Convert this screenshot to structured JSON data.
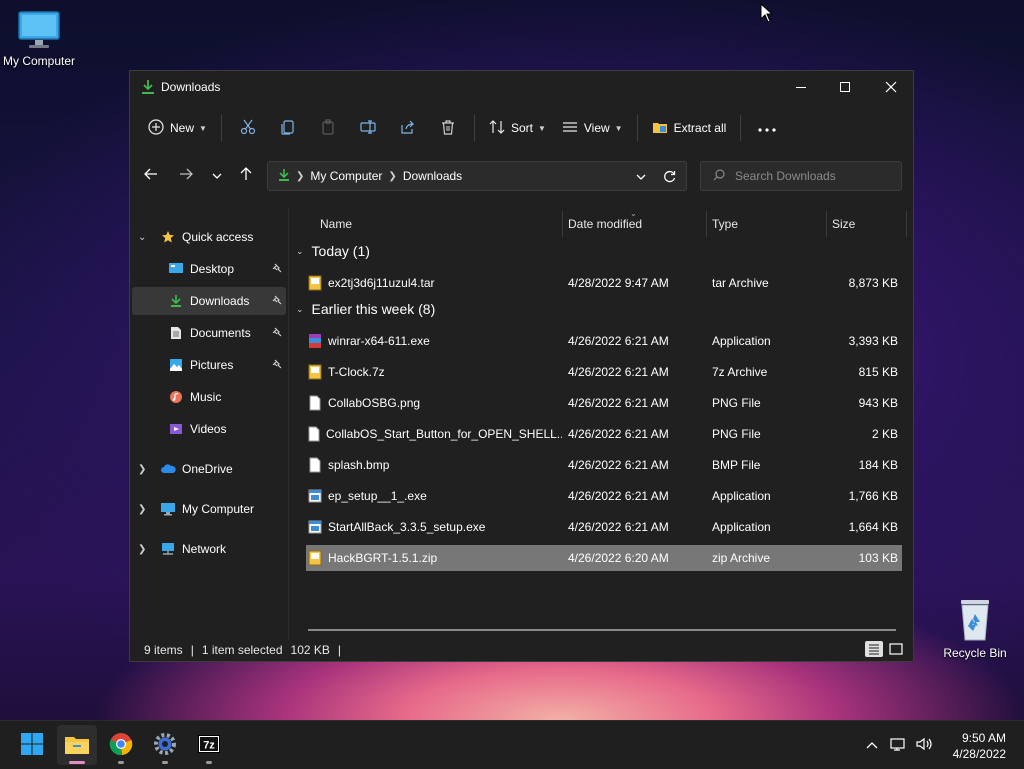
{
  "desktop": {
    "icons": [
      {
        "label": "My Computer"
      },
      {
        "label": "Recycle Bin"
      }
    ]
  },
  "window": {
    "title": "Downloads",
    "toolbar": {
      "new_label": "New",
      "sort_label": "Sort",
      "view_label": "View",
      "extract_label": "Extract all"
    },
    "address": {
      "segments": [
        "My Computer",
        "Downloads"
      ]
    },
    "search": {
      "placeholder": "Search Downloads"
    },
    "sidebar": {
      "quick_access": "Quick access",
      "items": [
        {
          "label": "Desktop",
          "icon": "desktop-icon",
          "pinned": true
        },
        {
          "label": "Downloads",
          "icon": "download-icon",
          "pinned": true,
          "selected": true
        },
        {
          "label": "Documents",
          "icon": "document-icon",
          "pinned": true
        },
        {
          "label": "Pictures",
          "icon": "picture-icon",
          "pinned": true
        },
        {
          "label": "Music",
          "icon": "music-icon",
          "pinned": false
        },
        {
          "label": "Videos",
          "icon": "video-icon",
          "pinned": false
        }
      ],
      "roots": [
        {
          "label": "OneDrive",
          "icon": "cloud-icon"
        },
        {
          "label": "My Computer",
          "icon": "computer-icon"
        },
        {
          "label": "Network",
          "icon": "network-icon"
        }
      ]
    },
    "columns": [
      "Name",
      "Date modified",
      "Type",
      "Size"
    ],
    "groups": [
      {
        "title": "Today (1)",
        "files": [
          {
            "name": "ex2tj3d6j11uzul4.tar",
            "date": "4/28/2022 9:47 AM",
            "type": "tar Archive",
            "size": "8,873 KB",
            "icon": "archive-icon"
          }
        ]
      },
      {
        "title": "Earlier this week (8)",
        "files": [
          {
            "name": "winrar-x64-611.exe",
            "date": "4/26/2022 6:21 AM",
            "type": "Application",
            "size": "3,393 KB",
            "icon": "winrar-icon"
          },
          {
            "name": "T-Clock.7z",
            "date": "4/26/2022 6:21 AM",
            "type": "7z Archive",
            "size": "815 KB",
            "icon": "archive-icon"
          },
          {
            "name": "CollabOSBG.png",
            "date": "4/26/2022 6:21 AM",
            "type": "PNG File",
            "size": "943 KB",
            "icon": "file-icon"
          },
          {
            "name": "CollabOS_Start_Button_for_OPEN_SHELL....",
            "date": "4/26/2022 6:21 AM",
            "type": "PNG File",
            "size": "2 KB",
            "icon": "file-icon"
          },
          {
            "name": "splash.bmp",
            "date": "4/26/2022 6:21 AM",
            "type": "BMP File",
            "size": "184 KB",
            "icon": "file-icon"
          },
          {
            "name": "ep_setup__1_.exe",
            "date": "4/26/2022 6:21 AM",
            "type": "Application",
            "size": "1,766 KB",
            "icon": "app-icon"
          },
          {
            "name": "StartAllBack_3.3.5_setup.exe",
            "date": "4/26/2022 6:21 AM",
            "type": "Application",
            "size": "1,664 KB",
            "icon": "app-icon"
          },
          {
            "name": "HackBGRT-1.5.1.zip",
            "date": "4/26/2022 6:20 AM",
            "type": "zip Archive",
            "size": "103 KB",
            "icon": "archive-icon",
            "selected": true
          }
        ]
      }
    ],
    "status": {
      "items": "9 items",
      "selected": "1 item selected",
      "size": "102 KB"
    }
  },
  "taskbar": {
    "time": "9:50 AM",
    "date": "4/28/2022"
  },
  "colors": {
    "window_bg": "#202020",
    "accent_green": "#3fb950",
    "folder_yellow": "#f4c542",
    "selected_row": "#777777"
  }
}
